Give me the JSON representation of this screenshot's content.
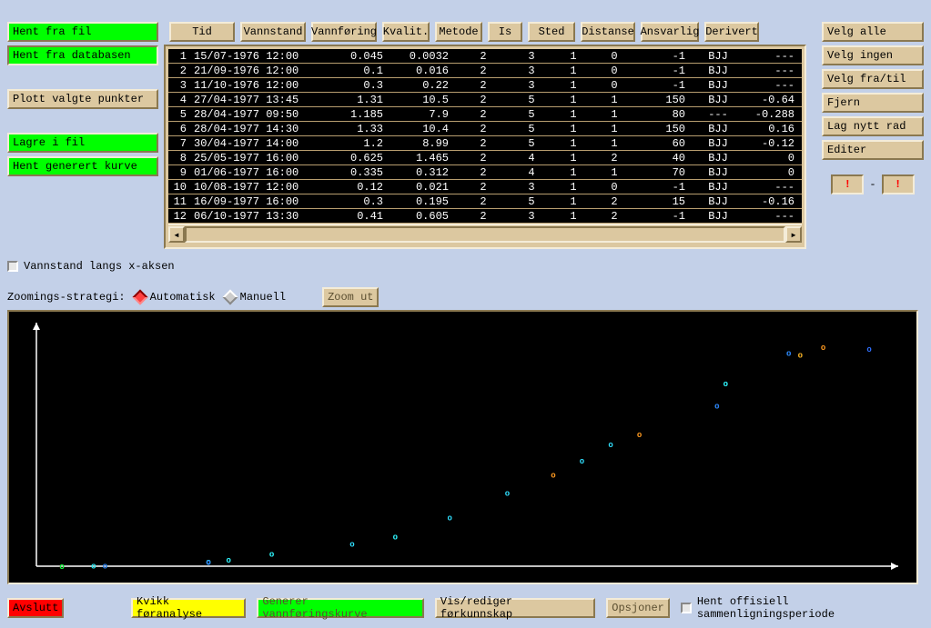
{
  "left": {
    "hent_fra_fil": "Hent fra fil",
    "hent_fra_db": "Hent fra databasen",
    "plott": "Plott valgte punkter",
    "lagre": "Lagre i fil",
    "hent_kurve": "Hent generert kurve"
  },
  "headers": {
    "tid": "Tid",
    "vannstand": "Vannstand",
    "vannforing": "Vannføring",
    "kvalit": "Kvalit.",
    "metode": "Metode",
    "is": "Is",
    "sted": "Sted",
    "distanse": "Distanse",
    "ansvarlig": "Ansvarlig",
    "derivert": "Derivert"
  },
  "right": {
    "velg_alle": "Velg alle",
    "velg_ingen": "Velg ingen",
    "velg_fra_til": "Velg fra/til",
    "fjern": "Fjern",
    "lag_nytt": "Lag nytt rad",
    "editer": "Editer",
    "range_from": "!",
    "range_to": "!",
    "range_sep": "-"
  },
  "rows": [
    {
      "idx": 1,
      "ts": "15/07-1976 12:00",
      "v1": "0.045",
      "v2": "0.0032",
      "q": 2,
      "m": 3,
      "is": 1,
      "st": 0,
      "d": "-1",
      "a": "BJJ",
      "dv": "---"
    },
    {
      "idx": 2,
      "ts": "21/09-1976 12:00",
      "v1": "0.1",
      "v2": "0.016",
      "q": 2,
      "m": 3,
      "is": 1,
      "st": 0,
      "d": "-1",
      "a": "BJJ",
      "dv": "---"
    },
    {
      "idx": 3,
      "ts": "11/10-1976 12:00",
      "v1": "0.3",
      "v2": "0.22",
      "q": 2,
      "m": 3,
      "is": 1,
      "st": 0,
      "d": "-1",
      "a": "BJJ",
      "dv": "---"
    },
    {
      "idx": 4,
      "ts": "27/04-1977 13:45",
      "v1": "1.31",
      "v2": "10.5",
      "q": 2,
      "m": 5,
      "is": 1,
      "st": 1,
      "d": "150",
      "a": "BJJ",
      "dv": "-0.64"
    },
    {
      "idx": 5,
      "ts": "28/04-1977 09:50",
      "v1": "1.185",
      "v2": "7.9",
      "q": 2,
      "m": 5,
      "is": 1,
      "st": 1,
      "d": "80",
      "a": "---",
      "dv": "-0.288"
    },
    {
      "idx": 6,
      "ts": "28/04-1977 14:30",
      "v1": "1.33",
      "v2": "10.4",
      "q": 2,
      "m": 5,
      "is": 1,
      "st": 1,
      "d": "150",
      "a": "BJJ",
      "dv": "0.16"
    },
    {
      "idx": 7,
      "ts": "30/04-1977 14:00",
      "v1": "1.2",
      "v2": "8.99",
      "q": 2,
      "m": 5,
      "is": 1,
      "st": 1,
      "d": "60",
      "a": "BJJ",
      "dv": "-0.12"
    },
    {
      "idx": 8,
      "ts": "25/05-1977 16:00",
      "v1": "0.625",
      "v2": "1.465",
      "q": 2,
      "m": 4,
      "is": 1,
      "st": 2,
      "d": "40",
      "a": "BJJ",
      "dv": "0"
    },
    {
      "idx": 9,
      "ts": "01/06-1977 16:00",
      "v1": "0.335",
      "v2": "0.312",
      "q": 2,
      "m": 4,
      "is": 1,
      "st": 1,
      "d": "70",
      "a": "BJJ",
      "dv": "0"
    },
    {
      "idx": 10,
      "ts": "10/08-1977 12:00",
      "v1": "0.12",
      "v2": "0.021",
      "q": 2,
      "m": 3,
      "is": 1,
      "st": 0,
      "d": "-1",
      "a": "BJJ",
      "dv": "---"
    },
    {
      "idx": 11,
      "ts": "16/09-1977 16:00",
      "v1": "0.3",
      "v2": "0.195",
      "q": 2,
      "m": 5,
      "is": 1,
      "st": 2,
      "d": "15",
      "a": "BJJ",
      "dv": "-0.16"
    },
    {
      "idx": 12,
      "ts": "06/10-1977 13:30",
      "v1": "0.41",
      "v2": "0.605",
      "q": 2,
      "m": 3,
      "is": 1,
      "st": 2,
      "d": "-1",
      "a": "BJJ",
      "dv": "---"
    }
  ],
  "controls": {
    "xaxis_label": "Vannstand langs x-aksen",
    "zoom_label": "Zoomings-strategi:",
    "auto": "Automatisk",
    "manuell": "Manuell",
    "zoomut": "Zoom ut"
  },
  "bottom": {
    "avslutt": "Avslutt",
    "kvikk": "Kvikk føranalyse",
    "generer": "Generer vannføringskurve",
    "vis": "Vis/rediger førkunnskap",
    "opsjoner": "Opsjoner",
    "hent_off": "Hent offisiell sammenligningsperiode"
  },
  "chart_data": {
    "type": "scatter",
    "title": "",
    "xlabel": "",
    "ylabel": "",
    "xlim": [
      0,
      1.5
    ],
    "ylim": [
      0,
      12
    ],
    "series": [
      {
        "name": "red",
        "color": "#ff2a2a",
        "points": [
          {
            "x": 0.045,
            "y": 0.0032
          }
        ]
      },
      {
        "name": "green",
        "color": "#00ff40",
        "points": [
          {
            "x": 0.045,
            "y": 0.0032
          },
          {
            "x": 0.1,
            "y": 0.016
          },
          {
            "x": 0.12,
            "y": 0.021
          },
          {
            "x": 0.3,
            "y": 0.22
          },
          {
            "x": 0.3,
            "y": 0.195
          },
          {
            "x": 0.335,
            "y": 0.312
          },
          {
            "x": 0.41,
            "y": 0.605
          },
          {
            "x": 0.625,
            "y": 1.465
          },
          {
            "x": 1.185,
            "y": 7.9
          },
          {
            "x": 1.2,
            "y": 8.99
          },
          {
            "x": 1.31,
            "y": 10.5
          },
          {
            "x": 1.33,
            "y": 10.4
          }
        ]
      },
      {
        "name": "cyan",
        "color": "#30e0ff",
        "points": [
          {
            "x": 0.1,
            "y": 0.016
          },
          {
            "x": 0.3,
            "y": 0.22
          },
          {
            "x": 0.335,
            "y": 0.312
          },
          {
            "x": 0.41,
            "y": 0.605
          },
          {
            "x": 0.55,
            "y": 1.1
          },
          {
            "x": 0.625,
            "y": 1.465
          },
          {
            "x": 0.72,
            "y": 2.4
          },
          {
            "x": 0.82,
            "y": 3.6
          },
          {
            "x": 0.95,
            "y": 5.2
          },
          {
            "x": 1.0,
            "y": 6.0
          },
          {
            "x": 1.2,
            "y": 8.99
          }
        ]
      },
      {
        "name": "orange",
        "color": "#ff9a20",
        "points": [
          {
            "x": 0.9,
            "y": 4.5
          },
          {
            "x": 1.05,
            "y": 6.5
          },
          {
            "x": 1.33,
            "y": 10.4
          },
          {
            "x": 1.37,
            "y": 10.8
          }
        ]
      },
      {
        "name": "blue",
        "color": "#3070ff",
        "points": [
          {
            "x": 0.12,
            "y": 0.021
          },
          {
            "x": 0.3,
            "y": 0.195
          },
          {
            "x": 1.185,
            "y": 7.9
          },
          {
            "x": 1.31,
            "y": 10.5
          },
          {
            "x": 1.45,
            "y": 10.7
          }
        ]
      }
    ]
  }
}
